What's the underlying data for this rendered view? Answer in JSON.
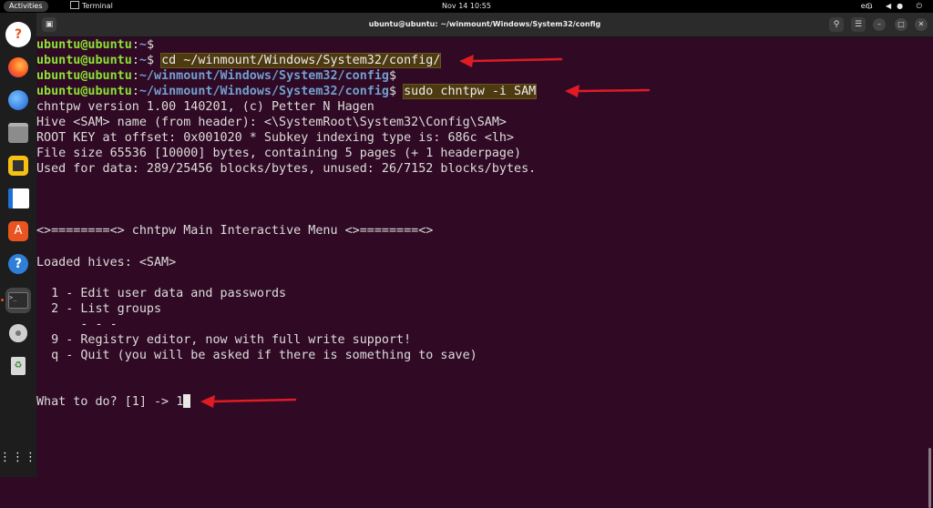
{
  "topbar": {
    "activities": "Activities",
    "app_name": "Terminal",
    "clock": "Nov 14  10:55",
    "lang": "en₁",
    "status_icons": "⬡ ◀● ⏻"
  },
  "window": {
    "title": "ubuntu@ubuntu: ~/winmount/Windows/System32/config"
  },
  "prompt": {
    "user": "ubuntu@ubuntu",
    "colon": ":",
    "dollar": "$ "
  },
  "terminal": {
    "lines": [
      {
        "path": "~",
        "cmd": ""
      },
      {
        "path": "~",
        "cmd": "cd ~/winmount/Windows/System32/config/"
      },
      {
        "path": "~/winmount/Windows/System32/config",
        "cmd": ""
      },
      {
        "path": "~/winmount/Windows/System32/config",
        "cmd": "sudo chntpw -i SAM"
      }
    ],
    "output": [
      "chntpw version 1.00 140201, (c) Petter N Hagen",
      "Hive <SAM> name (from header): <\\SystemRoot\\System32\\Config\\SAM>",
      "ROOT KEY at offset: 0x001020 * Subkey indexing type is: 686c <lh>",
      "File size 65536 [10000] bytes, containing 5 pages (+ 1 headerpage)",
      "Used for data: 289/25456 blocks/bytes, unused: 26/7152 blocks/bytes."
    ],
    "menu_title": "<>========<> chntpw Main Interactive Menu <>========<>",
    "loaded_hives": "Loaded hives: <SAM>",
    "menu_items": [
      "  1 - Edit user data and passwords",
      "  2 - List groups",
      "      - - -",
      "  9 - Registry editor, now with full write support!",
      "  q - Quit (you will be asked if there is something to save)"
    ],
    "question": "What to do? [1] -> ",
    "answer": "1"
  },
  "colors": {
    "background": "#300a24",
    "prompt_user": "#8ae234",
    "prompt_path": "#729fcf",
    "highlight": "#4e3a10",
    "arrow": "#e01b24"
  },
  "dock_icons": [
    "help-icon",
    "firefox-icon",
    "thunderbird-icon",
    "files-icon",
    "rhythmbox-icon",
    "writer-icon",
    "app-center-icon",
    "help-icon",
    "terminal-icon",
    "disc-icon",
    "trash-icon",
    "app-grid-icon"
  ]
}
